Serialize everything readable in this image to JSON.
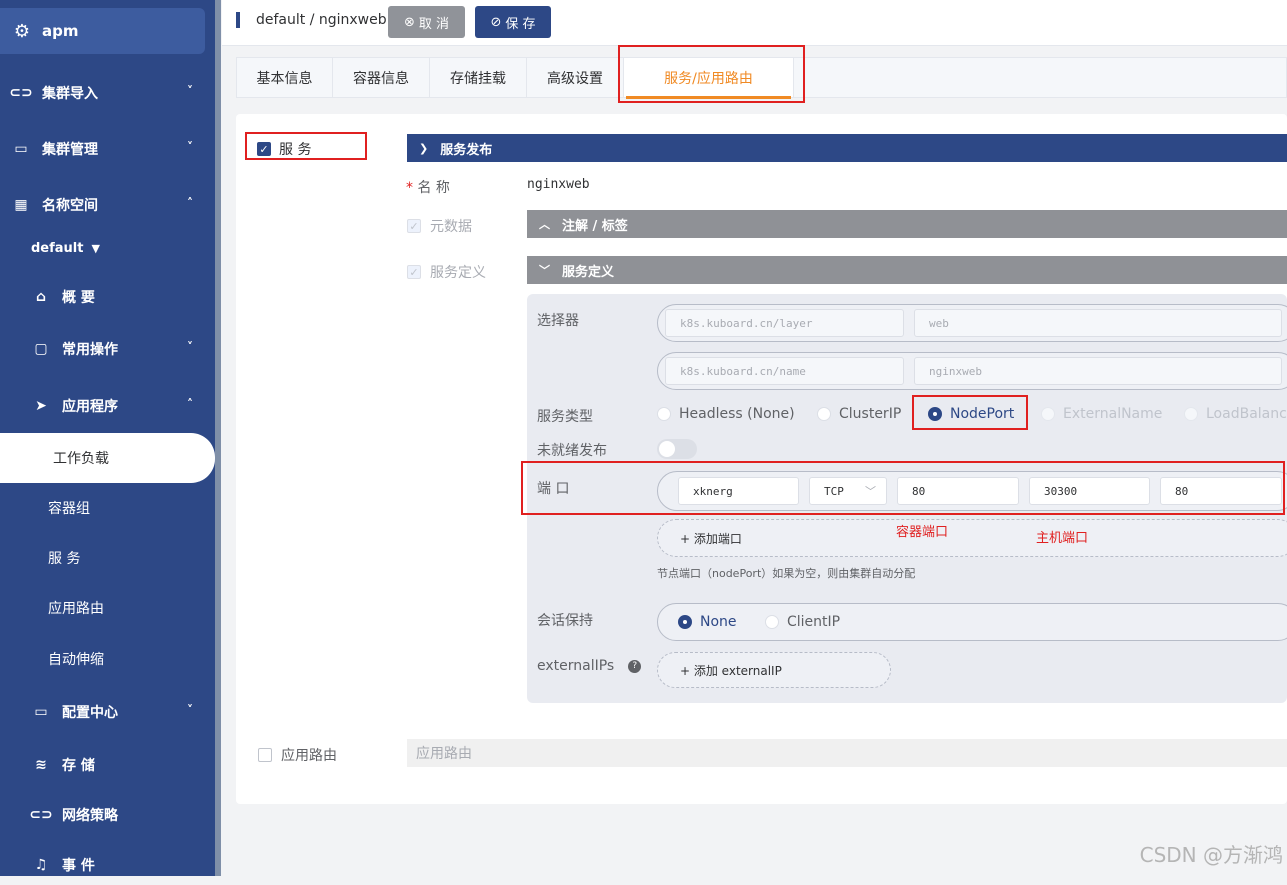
{
  "sidebar": {
    "brand": "apm",
    "items": [
      {
        "label": "集群导入",
        "icon": "link-icon",
        "chevron": "˅"
      },
      {
        "label": "集群管理",
        "icon": "box-icon",
        "chevron": "˅"
      },
      {
        "label": "名称空间",
        "icon": "grid-icon",
        "chevron": "˄"
      }
    ],
    "namespace": "default",
    "ns_items": [
      {
        "label": "概 要",
        "icon": "home-icon"
      },
      {
        "label": "常用操作",
        "icon": "folder-icon",
        "chevron": "˅"
      },
      {
        "label": "应用程序",
        "icon": "send-icon",
        "chevron": "˄"
      }
    ],
    "app_items": [
      "工作负载",
      "容器组",
      "服 务",
      "应用路由",
      "自动伸缩"
    ],
    "bottom_items": [
      {
        "label": "配置中心",
        "icon": "box-icon",
        "chevron": "˅"
      },
      {
        "label": "存 储",
        "icon": "database-icon"
      },
      {
        "label": "网络策略",
        "icon": "link-icon"
      },
      {
        "label": "事 件",
        "icon": "bell-icon"
      }
    ]
  },
  "topbar": {
    "breadcrumb": "default / nginxweb",
    "cancel_label": "取 消",
    "save_label": "保 存"
  },
  "tabs": [
    "基本信息",
    "容器信息",
    "存储挂载",
    "高级设置",
    "服务/应用路由"
  ],
  "form": {
    "service_checkbox_label": "服 务",
    "service_publish_header": "服务发布",
    "name_label": "名 称",
    "name_value": "nginxweb",
    "metadata_label": "元数据",
    "annotations_header": "注解 / 标签",
    "service_def_label": "服务定义",
    "service_def_header": "服务定义",
    "selector_label": "选择器",
    "selectors": [
      {
        "key": "k8s.kuboard.cn/layer",
        "value": "web"
      },
      {
        "key": "k8s.kuboard.cn/name",
        "value": "nginxweb"
      }
    ],
    "service_type_label": "服务类型",
    "service_types": [
      "Headless (None)",
      "ClusterIP",
      "NodePort",
      "ExternalName",
      "LoadBalancer"
    ],
    "selected_service_type": "NodePort",
    "unready_label": "未就绪发布",
    "port_label": "端 口",
    "port": {
      "name": "xknerg",
      "protocol": "TCP",
      "port": "80",
      "node_port": "30300",
      "target_port": "80"
    },
    "add_port_label": "+ 添加端口",
    "annotation_container_port": "容器端口",
    "annotation_host_port": "主机端口",
    "node_port_hint": "节点端口（nodePort）如果为空，则由集群自动分配",
    "session_label": "会话保持",
    "session_options": [
      "None",
      "ClientIP"
    ],
    "selected_session": "None",
    "external_ips_label": "externalIPs",
    "add_external_ip_label": "+ 添加 externalIP",
    "ingress_checkbox_label": "应用路由",
    "ingress_header": "应用路由"
  },
  "watermark": "CSDN @方渐鸿"
}
